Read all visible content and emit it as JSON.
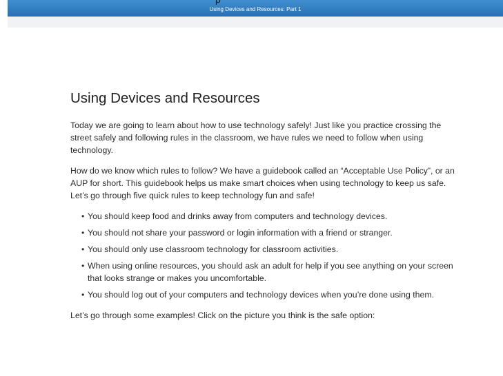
{
  "header": {
    "clipped_title_fragment": "p",
    "bar_title": "Using Devices and Resources: Part 1",
    "bar_color": "#2f7ec4"
  },
  "main": {
    "title": "Using Devices and Resources",
    "intro": "Today we are going to learn about how to use technology safely! Just like you practice crossing the street safely and following rules in the classroom, we have rules we need to follow when using technology.",
    "aup_paragraph": "How do we know which rules to follow? We have a guidebook called an “Acceptable Use Policy”, or an AUP for short. This guidebook helps us make smart choices when using technology to keep us safe. Let’s go through five quick rules to keep technology fun and safe!",
    "rules": [
      "You should keep food and drinks away from computers and technology devices.",
      "You should not share your password or login information with a friend or stranger.",
      "You should only use classroom technology for classroom activities.",
      "When using online resources, you should ask an adult for help if you see anything on your screen that looks strange or makes you uncomfortable.",
      "You should log out of your computers and technology devices when you’re done using them."
    ],
    "bullet_glyph": "•",
    "examples_prompt": "Let’s go through some examples! Click on the picture you think is the safe option:"
  }
}
